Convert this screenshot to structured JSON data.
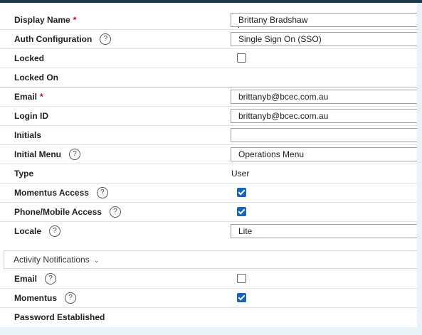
{
  "fields": {
    "display_name": {
      "label": "Display Name",
      "value": "Brittany Bradshaw"
    },
    "auth_configuration": {
      "label": "Auth Configuration",
      "value": "Single Sign On (SSO)"
    },
    "locked": {
      "label": "Locked",
      "checked": false
    },
    "locked_on": {
      "label": "Locked On"
    },
    "email": {
      "label": "Email",
      "value": "brittanyb@bcec.com.au"
    },
    "login_id": {
      "label": "Login ID",
      "value": "brittanyb@bcec.com.au"
    },
    "initials": {
      "label": "Initials",
      "value": ""
    },
    "initial_menu": {
      "label": "Initial Menu",
      "value": "Operations Menu"
    },
    "type": {
      "label": "Type",
      "value": "User"
    },
    "momentus_access": {
      "label": "Momentus Access",
      "checked": true
    },
    "phone_mobile_access": {
      "label": "Phone/Mobile Access",
      "checked": true
    },
    "locale": {
      "label": "Locale",
      "value": "Lite"
    }
  },
  "activity_notifications": {
    "label": "Activity Notifications",
    "email": {
      "label": "Email",
      "checked": false
    },
    "momentus": {
      "label": "Momentus",
      "checked": true
    }
  },
  "password_established": {
    "label": "Password Established"
  },
  "required_marker": "*",
  "help_glyph": "?",
  "chevron_glyph": "⌄",
  "colors": {
    "checkbox_accent": "#1565c0",
    "required": "#d0021b",
    "top_bar": "#1d3a4a"
  }
}
